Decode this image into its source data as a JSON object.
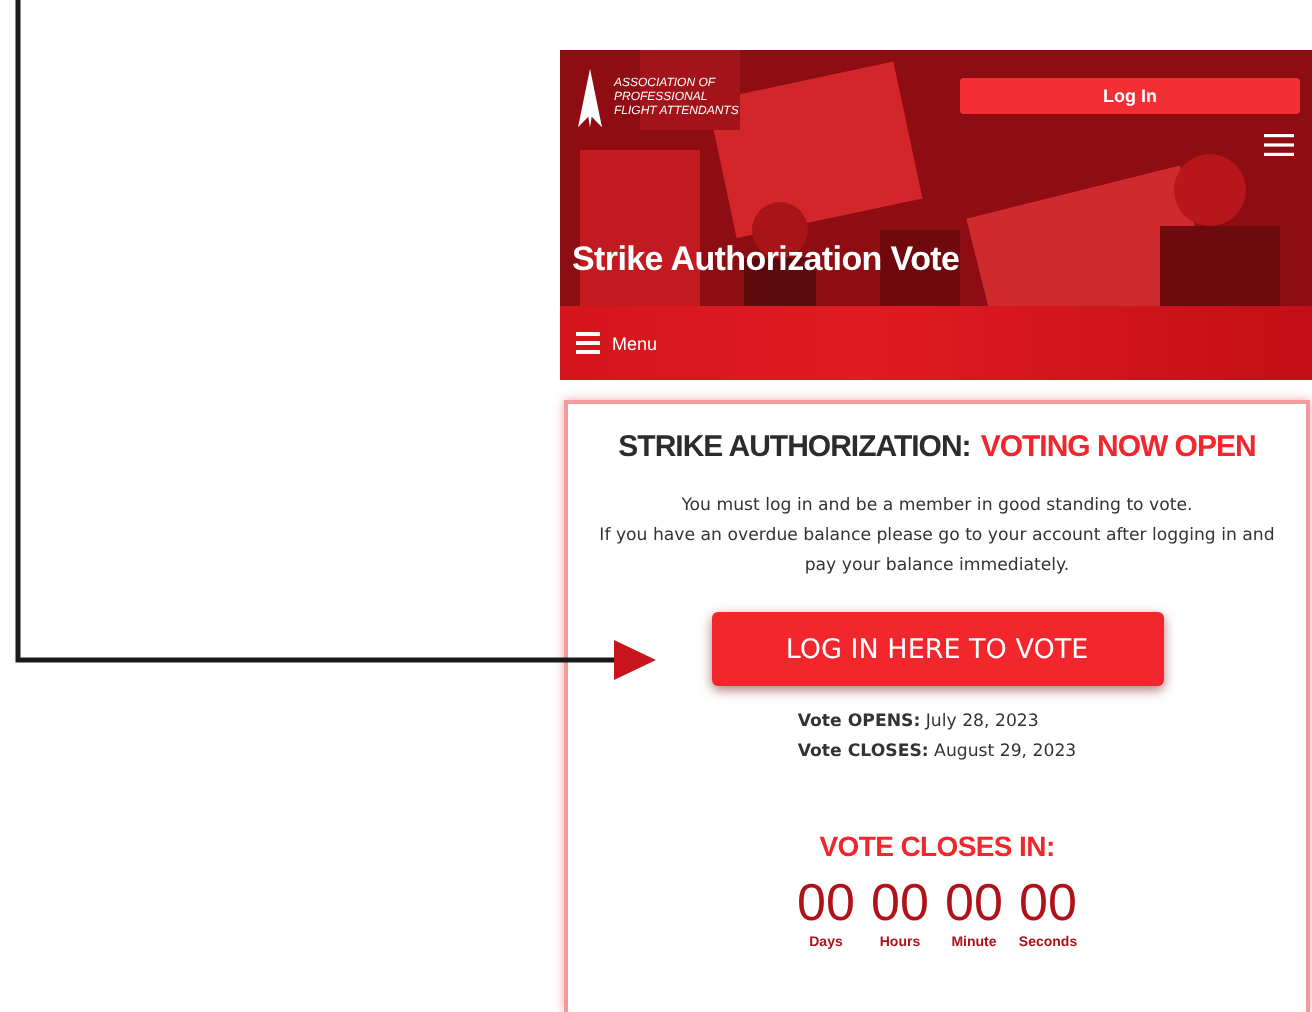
{
  "header": {
    "logo_text": [
      "ASSOCIATION OF",
      "PROFESSIONAL",
      "FLIGHT ATTENDANTS"
    ],
    "login_button": "Log In",
    "title": "Strike Authorization Vote"
  },
  "menu_bar": {
    "label": "Menu"
  },
  "card": {
    "heading": {
      "lead": "STRIKE AUTHORIZATION:",
      "highlight": "VOTING NOW OPEN"
    },
    "notice": [
      "You must log in and be a member in good standing to vote.",
      "If you have an overdue balance please go to your account after logging in and pay your balance immediately."
    ],
    "vote_button": "LOG IN HERE TO VOTE",
    "dates": [
      "**Vote OPENS:** July 28, 2023",
      "**Vote CLOSES:** August 29, 2023"
    ],
    "countdown_title": "VOTE CLOSES IN:",
    "countdown": [
      {
        "value": "00",
        "label": "Days"
      },
      {
        "value": "00",
        "label": "Hours"
      },
      {
        "value": "00",
        "label": "Minute"
      },
      {
        "value": "00",
        "label": "Seconds"
      }
    ]
  }
}
